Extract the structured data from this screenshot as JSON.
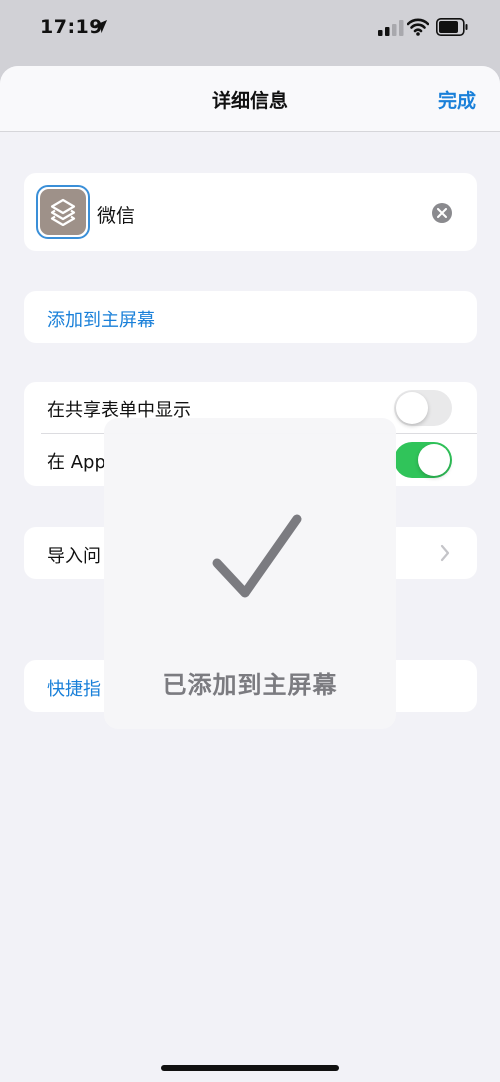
{
  "status": {
    "time": "17:19",
    "icons": [
      "location-arrow-icon",
      "cellular-signal-icon",
      "wifi-icon",
      "battery-icon"
    ]
  },
  "nav": {
    "title": "详细信息",
    "done_label": "完成"
  },
  "shortcut": {
    "name": "微信",
    "icon": "shortcuts-layers-icon",
    "icon_color": "#9e9189"
  },
  "add_to_home": {
    "label": "添加到主屏幕"
  },
  "toggles": [
    {
      "label": "在共享表单中显示",
      "on": false
    },
    {
      "label": "在 App",
      "on": true
    }
  ],
  "import_row": {
    "label": "导入问"
  },
  "help_row": {
    "label": "快捷指"
  },
  "hud": {
    "icon": "checkmark-icon",
    "message": "已添加到主屏幕"
  },
  "colors": {
    "accent": "#1a80d9",
    "toggle_on": "#30c45a",
    "toggle_off": "#e9e9ea"
  }
}
